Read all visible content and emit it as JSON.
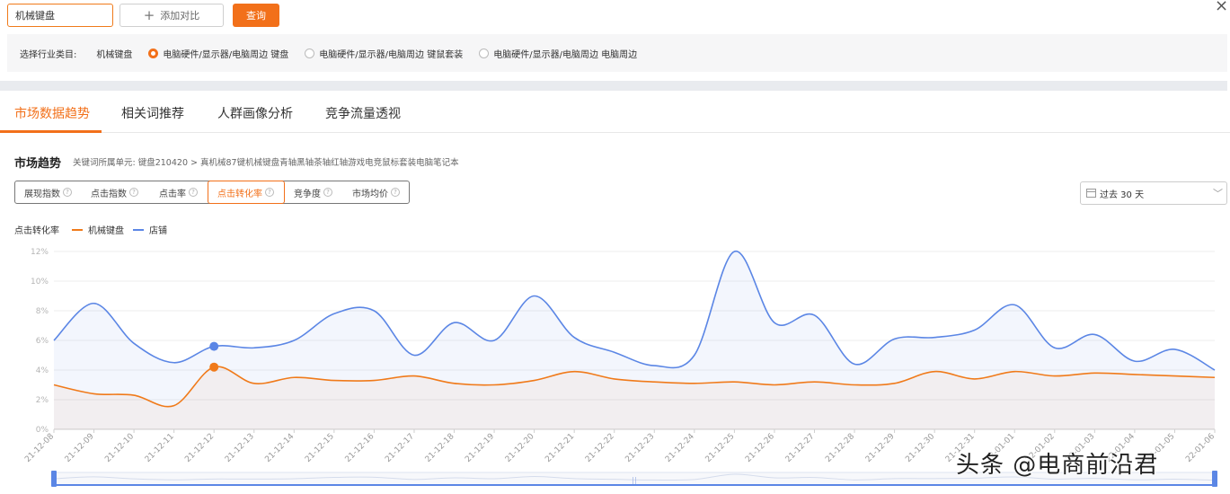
{
  "search": {
    "value": "机械键盘"
  },
  "toolbar": {
    "add_label": "添加对比",
    "query_label": "查询"
  },
  "category": {
    "label": "选择行业类目:",
    "current": "机械键盘",
    "options": [
      {
        "label": "电脑硬件/显示器/电脑周边 键盘",
        "selected": true
      },
      {
        "label": "电脑硬件/显示器/电脑周边 键鼠套装",
        "selected": false
      },
      {
        "label": "电脑硬件/显示器/电脑周边 电脑周边",
        "selected": false
      }
    ]
  },
  "tabs": [
    "市场数据趋势",
    "相关词推荐",
    "人群画像分析",
    "竞争流量透视"
  ],
  "section": {
    "title": "市场趋势",
    "breadcrumb": "关键词所属单元: 键盘210420 > 真机械87键机械键盘青轴黑轴茶轴红轴游戏电竞鼠标套装电脑笔记本"
  },
  "metrics": [
    "展现指数",
    "点击指数",
    "点击率",
    "点击转化率",
    "竞争度",
    "市场均价"
  ],
  "active_metric": "点击转化率",
  "date_range": "过去 30 天",
  "legend": {
    "metric": "点击转化率",
    "series": [
      "机械键盘",
      "店铺"
    ]
  },
  "colors": {
    "accent": "#f2701a",
    "series_keyboard": "#f07a1a",
    "series_shop": "#5b86e5"
  },
  "watermark": "头条 @电商前沿君",
  "chart_data": {
    "type": "line",
    "x": [
      "21-12-08",
      "21-12-09",
      "21-12-10",
      "21-12-11",
      "21-12-12",
      "21-12-13",
      "21-12-14",
      "21-12-15",
      "21-12-16",
      "21-12-17",
      "21-12-18",
      "21-12-19",
      "21-12-20",
      "21-12-21",
      "21-12-22",
      "21-12-23",
      "21-12-24",
      "21-12-25",
      "21-12-26",
      "21-12-27",
      "21-12-28",
      "21-12-29",
      "21-12-30",
      "21-12-31",
      "22-01-01",
      "22-01-02",
      "22-01-03",
      "22-01-04",
      "22-01-05",
      "22-01-06"
    ],
    "series": [
      {
        "name": "机械键盘",
        "values": [
          3.0,
          2.4,
          2.3,
          1.6,
          4.2,
          3.1,
          3.5,
          3.3,
          3.3,
          3.6,
          3.1,
          3.0,
          3.3,
          3.9,
          3.4,
          3.2,
          3.1,
          3.2,
          3.0,
          3.2,
          3.0,
          3.1,
          3.9,
          3.4,
          3.9,
          3.6,
          3.8,
          3.7,
          3.6,
          3.5
        ]
      },
      {
        "name": "店铺",
        "values": [
          6.0,
          8.5,
          5.8,
          4.5,
          5.6,
          5.5,
          6.0,
          7.8,
          8.0,
          5.0,
          7.2,
          6.0,
          9.0,
          6.2,
          5.2,
          4.3,
          5.0,
          12.0,
          7.2,
          7.7,
          4.4,
          6.1,
          6.2,
          6.7,
          8.4,
          5.5,
          6.4,
          4.6,
          5.4,
          4.0
        ]
      }
    ],
    "y_ticks": [
      "0%",
      "2%",
      "4%",
      "6%",
      "8%",
      "10%",
      "12%"
    ],
    "ylim": [
      0,
      12
    ],
    "highlight_index": 4,
    "grid": true,
    "legend_position": "top-left"
  }
}
